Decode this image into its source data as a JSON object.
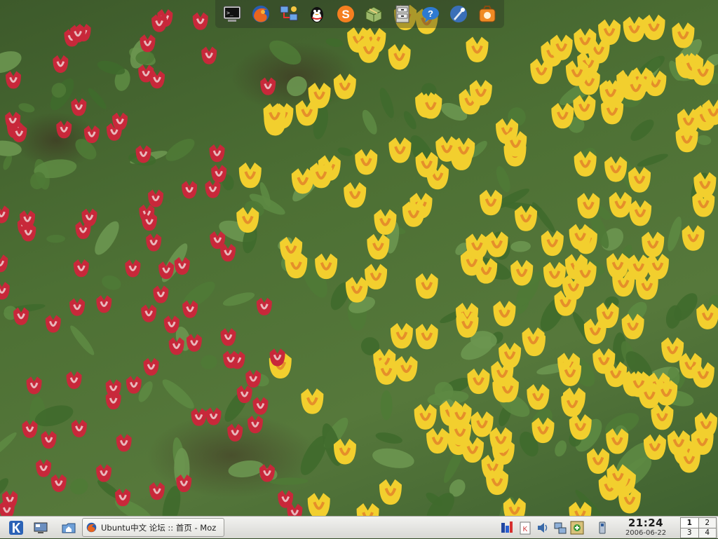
{
  "dock": {
    "items": [
      {
        "icon": "terminal-icon"
      },
      {
        "icon": "firefox-icon"
      },
      {
        "icon": "network-icon"
      },
      {
        "icon": "qq-penguin-icon"
      },
      {
        "icon": "skype-icon"
      },
      {
        "icon": "package-icon"
      },
      {
        "icon": "file-cabinet-icon"
      },
      {
        "icon": "help-icon"
      },
      {
        "icon": "konqueror-icon"
      },
      {
        "icon": "software-icon"
      }
    ]
  },
  "panel": {
    "taskbar_item": {
      "label": "Ubuntu中文 论坛 :: 首页 - Moz",
      "icon": "firefox-icon"
    },
    "clock": {
      "time": "21:24",
      "date": "2006-06-22"
    },
    "pager": {
      "desktops": [
        "1",
        "2",
        "3",
        "4"
      ],
      "active": "1"
    }
  },
  "colors": {
    "panel_bg": "#e6e6e2",
    "tulip_red": "#c8283a",
    "tulip_yellow": "#f2cf2e"
  }
}
